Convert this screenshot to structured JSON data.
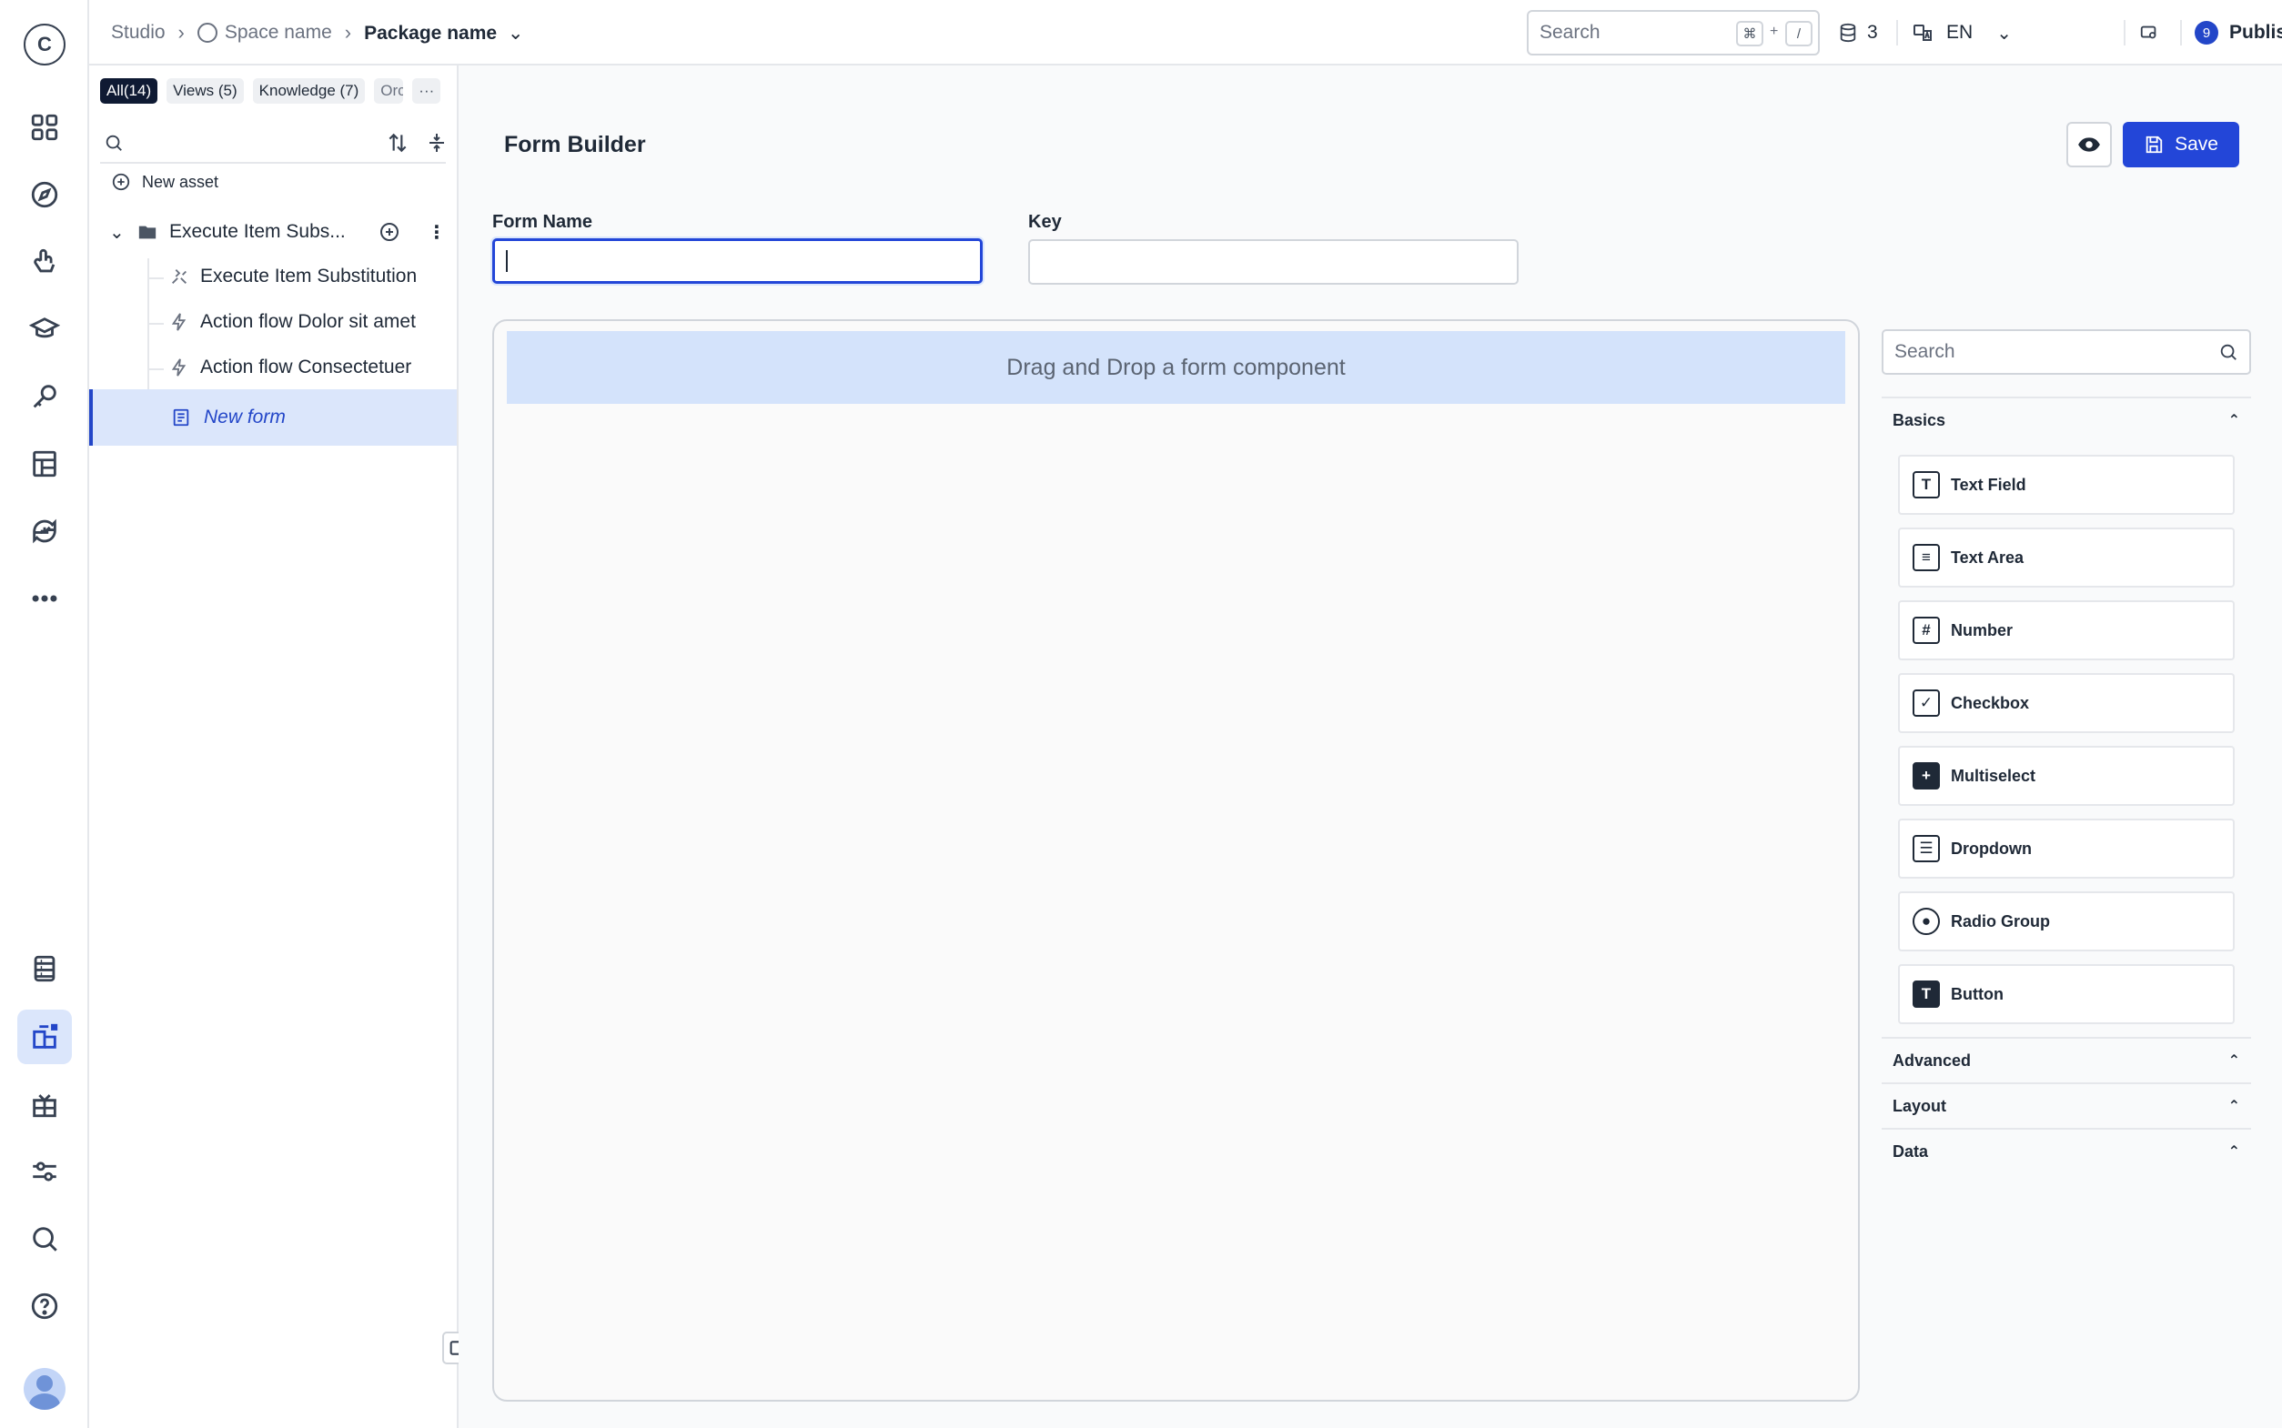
{
  "app": {
    "logo_letter": "C"
  },
  "breadcrumb": {
    "studio": "Studio",
    "space": "Space name",
    "package": "Package name"
  },
  "topbar": {
    "search_placeholder": "Search",
    "shortcut_mod": "⌘",
    "shortcut_plus": "+",
    "shortcut_key": "/",
    "db_count": "3",
    "language": "EN",
    "publish_badge": "9",
    "publish_label": "Publish"
  },
  "assets": {
    "tabs": [
      {
        "label": "All(14)"
      },
      {
        "label": "Views (5)"
      },
      {
        "label": "Knowledge (7)"
      },
      {
        "label": "Orc"
      },
      {
        "label": "···"
      }
    ],
    "new_asset": "New asset",
    "folder": "Execute Item Subs...",
    "items": [
      {
        "label": "Execute Item Substitution",
        "icon": "substitution-icon"
      },
      {
        "label": "Action flow Dolor sit amet",
        "icon": "lightning-icon"
      },
      {
        "label": "Action flow Consectetuer",
        "icon": "lightning-icon"
      },
      {
        "label": "New form",
        "icon": "form-icon"
      }
    ]
  },
  "builder": {
    "title": "Form Builder",
    "save_label": "Save",
    "form_name_label": "Form Name",
    "form_name_value": "",
    "key_label": "Key",
    "key_value": "",
    "dropzone_text": "Drag and Drop a form component"
  },
  "palette": {
    "search_placeholder": "Search",
    "sections": {
      "basics": "Basics",
      "advanced": "Advanced",
      "layout": "Layout",
      "data": "Data"
    },
    "components": [
      {
        "label": "Text Field",
        "glyph": "T"
      },
      {
        "label": "Text Area",
        "glyph": "≡"
      },
      {
        "label": "Number",
        "glyph": "#"
      },
      {
        "label": "Checkbox",
        "glyph": "✓"
      },
      {
        "label": "Multiselect",
        "glyph": "+"
      },
      {
        "label": "Dropdown",
        "glyph": "☰"
      },
      {
        "label": "Radio Group",
        "glyph": "●"
      },
      {
        "label": "Button",
        "glyph": "T"
      }
    ]
  },
  "colors": {
    "accent": "#2346d8",
    "selected_bg": "#dbe6fb",
    "dropzone_bg": "#d4e3fb"
  }
}
